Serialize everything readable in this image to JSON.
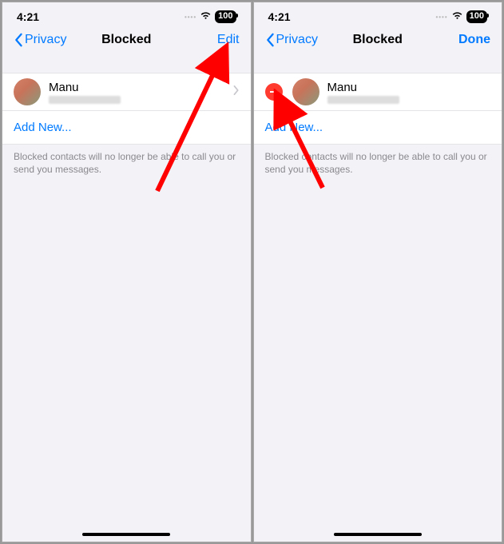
{
  "status": {
    "time": "4:21",
    "battery": "100"
  },
  "nav": {
    "back": "Privacy",
    "title": "Blocked",
    "edit": "Edit",
    "done": "Done"
  },
  "contact": {
    "name": "Manu"
  },
  "addNew": "Add New...",
  "footer": "Blocked contacts will no longer be able to call you or send you messages."
}
